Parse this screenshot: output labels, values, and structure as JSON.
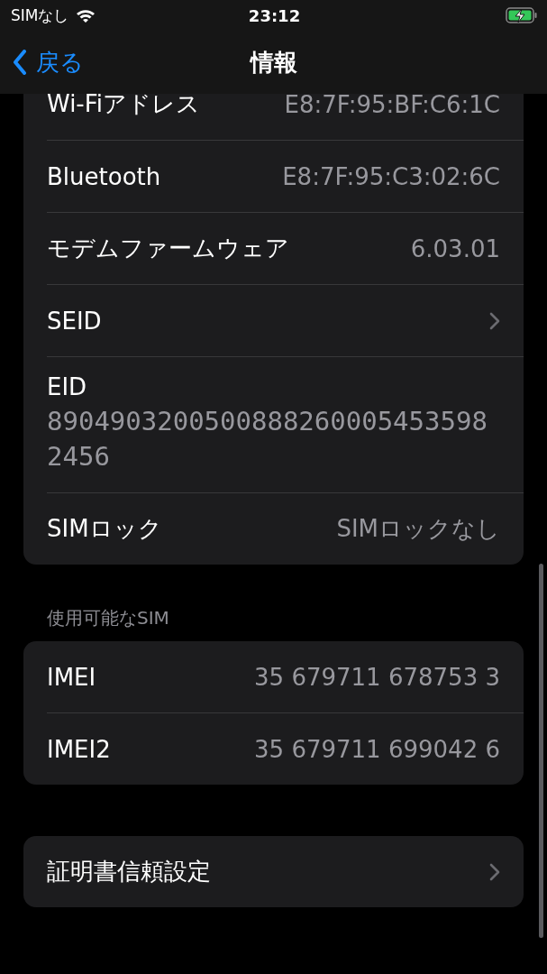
{
  "status_bar": {
    "carrier": "SIMなし",
    "time": "23:12",
    "charging": true
  },
  "nav": {
    "back": "戻る",
    "title": "情報"
  },
  "sections": [
    {
      "rows": [
        {
          "kind": "value",
          "label": "Wi-Fiアドレス",
          "value": "E8:7F:95:BF:C6:1C"
        },
        {
          "kind": "value",
          "label": "Bluetooth",
          "value": "E8:7F:95:C3:02:6C"
        },
        {
          "kind": "value",
          "label": "モデムファームウェア",
          "value": "6.03.01"
        },
        {
          "kind": "link",
          "label": "SEID"
        },
        {
          "kind": "stacked",
          "label": "EID",
          "value": "89049032005008882600054535982456"
        },
        {
          "kind": "value",
          "label": "SIMロック",
          "value": "SIMロックなし"
        }
      ]
    },
    {
      "header": "使用可能なSIM",
      "rows": [
        {
          "kind": "value",
          "label": "IMEI",
          "value": "35 679711 678753 3"
        },
        {
          "kind": "value",
          "label": "IMEI2",
          "value": "35 679711 699042 6"
        }
      ]
    },
    {
      "rows": [
        {
          "kind": "link",
          "label": "証明書信頼設定"
        }
      ]
    }
  ]
}
